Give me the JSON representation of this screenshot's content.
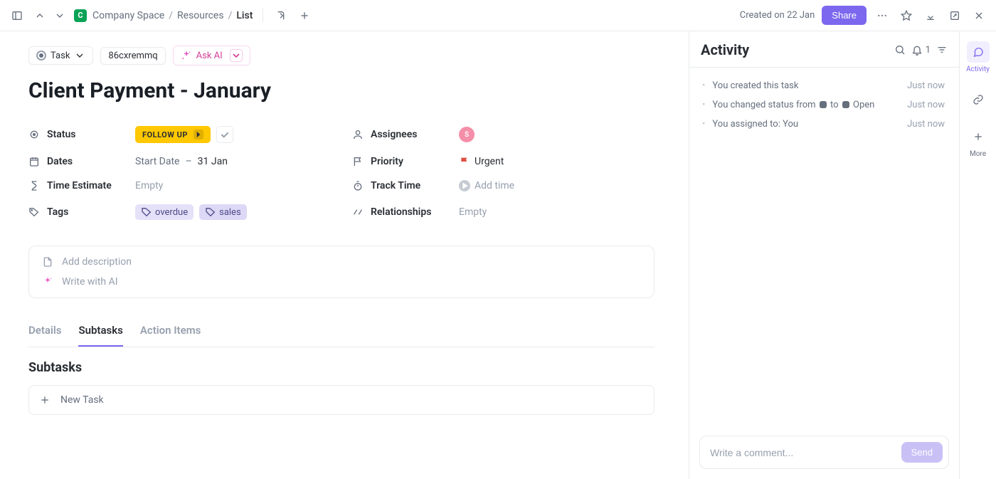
{
  "topbar": {
    "space_initial": "C",
    "breadcrumb": [
      "Company Space",
      "Resources",
      "List"
    ],
    "created_text": "Created on 22 Jan",
    "share_label": "Share"
  },
  "chips": {
    "task_type": "Task",
    "task_id": "86cxremmq",
    "ask_ai": "Ask AI"
  },
  "task_title": "Client Payment - January",
  "fields": {
    "status": {
      "label": "Status",
      "value": "FOLLOW UP"
    },
    "assignees": {
      "label": "Assignees",
      "initial": "S"
    },
    "dates": {
      "label": "Dates",
      "start": "Start Date",
      "end": "31 Jan"
    },
    "priority": {
      "label": "Priority",
      "value": "Urgent"
    },
    "time_estimate": {
      "label": "Time Estimate",
      "value": "Empty"
    },
    "track_time": {
      "label": "Track Time",
      "value": "Add time"
    },
    "tags": {
      "label": "Tags",
      "values": [
        "overdue",
        "sales"
      ]
    },
    "relationships": {
      "label": "Relationships",
      "value": "Empty"
    }
  },
  "description": {
    "add": "Add description",
    "write_ai": "Write with AI"
  },
  "tabs": [
    "Details",
    "Subtasks",
    "Action Items"
  ],
  "active_tab_index": 1,
  "subtasks": {
    "heading": "Subtasks",
    "new_task": "New Task"
  },
  "activity": {
    "title": "Activity",
    "notify_count": "1",
    "items": [
      {
        "text": "You created this task",
        "time": "Just now"
      },
      {
        "text_prefix": "You changed status from ",
        "text_mid": " to ",
        "text_suffix": " Open",
        "time": "Just now",
        "status_change": true
      },
      {
        "text": "You assigned to: You",
        "time": "Just now"
      }
    ],
    "comment_placeholder": "Write a comment...",
    "send_label": "Send"
  },
  "rail": {
    "activity_label": "Activity",
    "more_label": "More"
  }
}
